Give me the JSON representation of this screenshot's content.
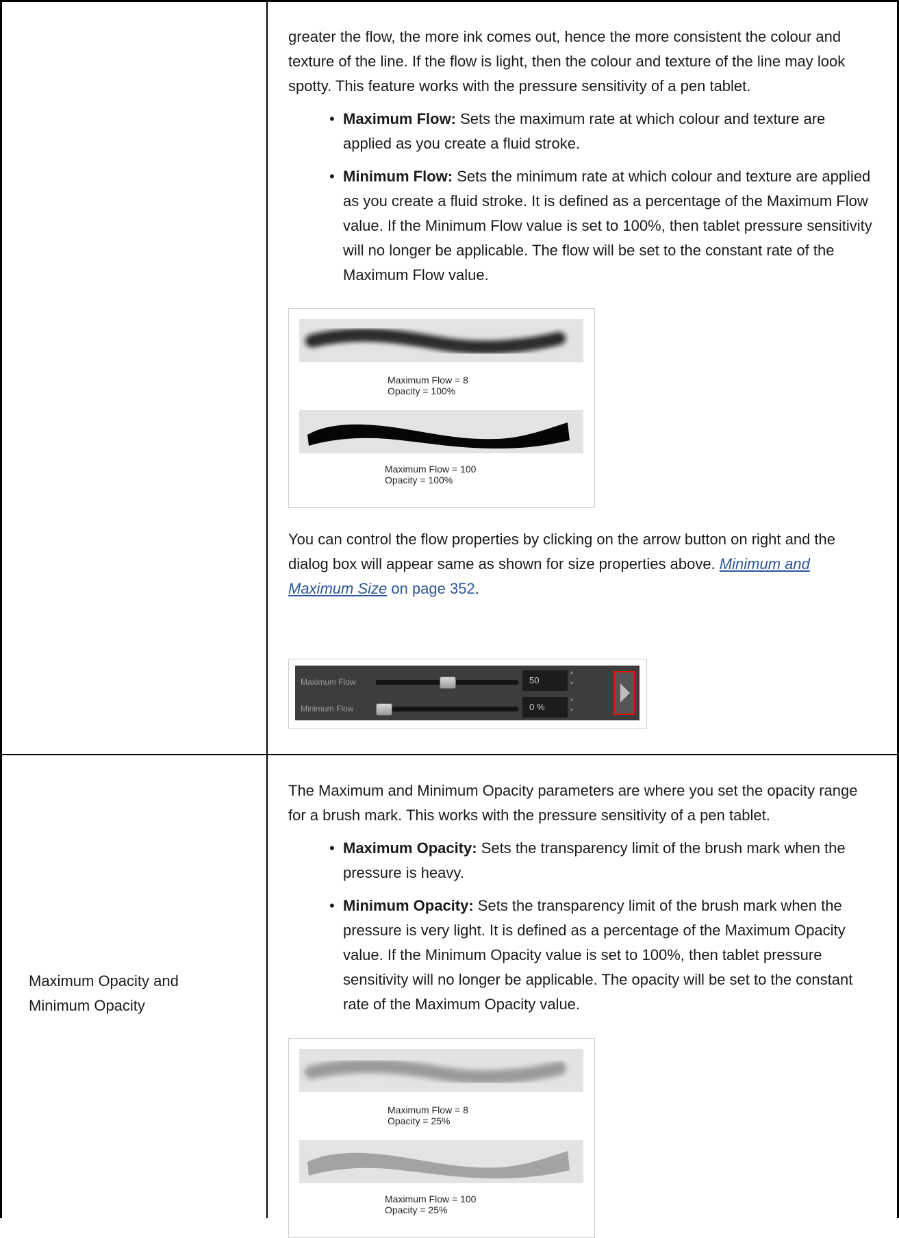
{
  "row1": {
    "para_intro": "greater the flow, the more ink comes out, hence the more consistent the colour and texture of the line. If the flow is light, then the colour and texture of the line may look spotty. This feature works with the pressure sensitivity of a pen tablet.",
    "bullets": [
      {
        "term": "Maximum Flow:",
        "text": " Sets the maximum rate at which colour and texture are applied as you create a fluid stroke."
      },
      {
        "term": "Minimum Flow:",
        "text": " Sets the minimum rate at which colour and texture are applied as you create a fluid stroke. It is defined as a percentage of the Maximum Flow value. If the Minimum Flow value is set to 100%, then tablet pressure sensitivity will no longer be applicable. The flow will be set to the constant rate of the Maximum Flow value."
      }
    ],
    "figure": {
      "cap1_line1": "Maximum Flow = 8",
      "cap1_line2": "Opacity = 100%",
      "cap2_line1": "Maximum Flow = 100",
      "cap2_line2": "Opacity = 100%"
    },
    "para_control_before": "You can control the flow properties by clicking on the arrow button on right and the dialog box will appear same as shown for size properties above. ",
    "link_text": "Minimum and Maximum Size",
    "page_ref": " on page 352",
    "para_end": ".",
    "slider_panel": {
      "max_label": "Maximum Flow",
      "min_label": "Minimum Flow",
      "max_value": "50",
      "min_value": "0 %",
      "max_level": 0.5,
      "min_level": 0.0
    }
  },
  "row2": {
    "label_line1": "Maximum Opacity and",
    "label_line2": "Minimum Opacity",
    "para_intro": "The Maximum and Minimum Opacity parameters are where you set the opacity range for a brush mark. This works with the pressure sensitivity of a pen tablet.",
    "bullets": [
      {
        "term": "Maximum Opacity:",
        "text": " Sets the transparency limit of the brush mark when the pressure is heavy."
      },
      {
        "term": "Minimum Opacity:",
        "text": " Sets the transparency limit of the brush mark when the pressure is very light. It is defined as a percentage of the Maximum Opacity value. If the Minimum Opacity value is set to 100%, then tablet pressure sensitivity will no longer be applicable. The opacity will be set to the constant rate of the Maximum Opacity value."
      }
    ],
    "figure": {
      "cap1_line1": "Maximum Flow = 8",
      "cap1_line2": "Opacity = 25%",
      "cap2_line1": "Maximum Flow = 100",
      "cap2_line2": "Opacity = 25%"
    }
  },
  "bullet_glyph": "•",
  "colors": {
    "link": "#2b5797",
    "highlight": "#dd1111",
    "panel_bg": "#3d3d3d"
  }
}
